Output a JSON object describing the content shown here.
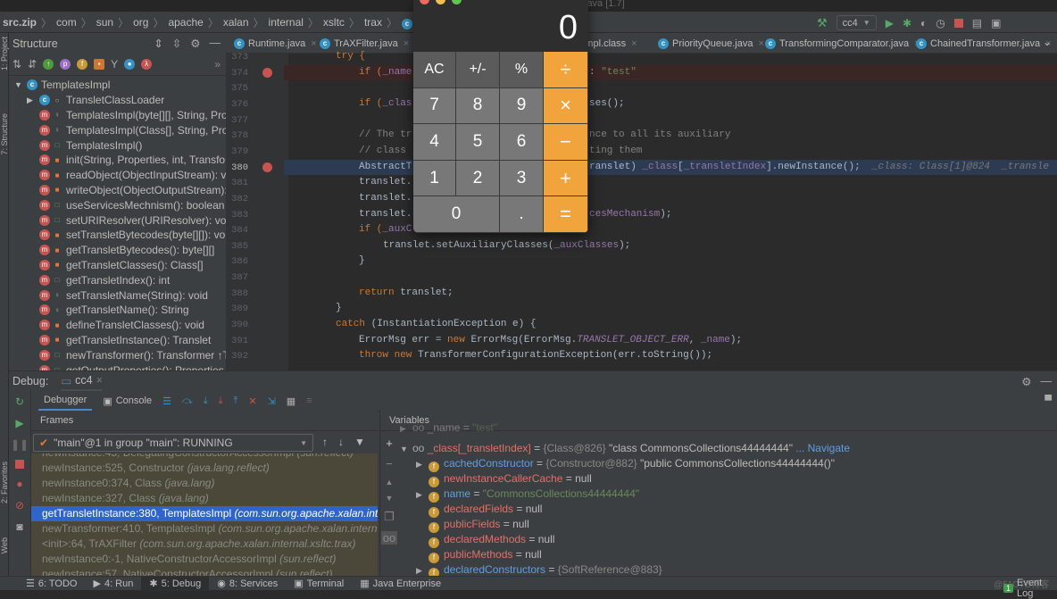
{
  "titlebar": {
    "text": "java [1.7]"
  },
  "breadcrumb": [
    "src.zip",
    "com",
    "sun",
    "org",
    "apache",
    "xalan",
    "internal",
    "xsltc",
    "trax",
    "TemplatesImpl"
  ],
  "run_config": "cc4",
  "structure": {
    "title": "Structure",
    "root": "TemplatesImpl",
    "items": [
      {
        "label": "TransletClassLoader",
        "kind": "class",
        "access": "package"
      },
      {
        "label": "TemplatesImpl(byte[][], String, Pro",
        "kind": "method",
        "access": "protected"
      },
      {
        "label": "TemplatesImpl(Class[], String, Prop",
        "kind": "method",
        "access": "protected"
      },
      {
        "label": "TemplatesImpl()",
        "kind": "method",
        "access": "public"
      },
      {
        "label": "init(String, Properties, int, Transfor",
        "kind": "method",
        "access": "private"
      },
      {
        "label": "readObject(ObjectInputStream): vo",
        "kind": "method",
        "access": "private"
      },
      {
        "label": "writeObject(ObjectOutputStream):",
        "kind": "method",
        "access": "private"
      },
      {
        "label": "useServicesMechnism(): boolean",
        "kind": "method",
        "access": "public"
      },
      {
        "label": "setURIResolver(URIResolver): void",
        "kind": "method",
        "access": "public"
      },
      {
        "label": "setTransletBytecodes(byte[][]): vo",
        "kind": "method",
        "access": "private"
      },
      {
        "label": "getTransletBytecodes(): byte[][]",
        "kind": "method",
        "access": "private"
      },
      {
        "label": "getTransletClasses(): Class[]",
        "kind": "method",
        "access": "private"
      },
      {
        "label": "getTransletIndex(): int",
        "kind": "method",
        "access": "public"
      },
      {
        "label": "setTransletName(String): void",
        "kind": "method",
        "access": "protected"
      },
      {
        "label": "getTransletName(): String",
        "kind": "method",
        "access": "protected"
      },
      {
        "label": "defineTransletClasses(): void",
        "kind": "method",
        "access": "private"
      },
      {
        "label": "getTransletInstance(): Translet",
        "kind": "method",
        "access": "private"
      },
      {
        "label": "newTransformer(): Transformer ↑Te",
        "kind": "method",
        "access": "public"
      },
      {
        "label": "getOutputProperties(): Properties",
        "kind": "method",
        "access": "public"
      }
    ]
  },
  "tabs": [
    {
      "label": "Runtime.java"
    },
    {
      "label": "TrAXFilter.java"
    },
    {
      "label": "onImpl.class"
    },
    {
      "label": "PriorityQueue.java"
    },
    {
      "label": "TransformingComparator.java"
    },
    {
      "label": "ChainedTransformer.java"
    }
  ],
  "code": [
    {
      "n": "373",
      "indent": 2,
      "left": [
        [
          "try {",
          "kw"
        ]
      ]
    },
    {
      "n": "374",
      "indent": 3,
      "bp": true,
      "hl": "error",
      "left": [
        [
          "if (",
          "kw"
        ],
        [
          "_name",
          "fld"
        ]
      ],
      "right": [
        [
          ": ",
          "pl"
        ],
        [
          "\"test\"",
          "str"
        ]
      ]
    },
    {
      "n": "375",
      "indent": 3,
      "left": []
    },
    {
      "n": "376",
      "indent": 3,
      "left": [
        [
          "if (",
          "kw"
        ],
        [
          "_clas",
          "fld"
        ]
      ],
      "right": [
        [
          "ses();",
          "pl"
        ]
      ]
    },
    {
      "n": "377",
      "indent": 3,
      "left": []
    },
    {
      "n": "378",
      "indent": 3,
      "left": [
        [
          "// The tr",
          "cm"
        ]
      ],
      "right": [
        [
          "nce to all its auxiliary",
          "cm"
        ]
      ]
    },
    {
      "n": "379",
      "indent": 3,
      "left": [
        [
          "// class ",
          "cm"
        ]
      ],
      "right": [
        [
          "ting them",
          "cm"
        ]
      ]
    },
    {
      "n": "380",
      "indent": 3,
      "bp": true,
      "hl": "exec",
      "left": [
        [
          "AbstractT",
          "pl"
        ]
      ],
      "right": [
        [
          "ranslet) ",
          "pl"
        ],
        [
          "_class",
          "fld"
        ],
        [
          "[",
          "pl"
        ],
        [
          "_transletIndex",
          "fld"
        ],
        [
          "].newInstance();",
          "pl"
        ],
        [
          "  _class: Class[1]@824  _transle",
          "hint"
        ]
      ]
    },
    {
      "n": "381",
      "indent": 3,
      "left": [
        [
          "translet.",
          "pl"
        ]
      ]
    },
    {
      "n": "382",
      "indent": 3,
      "left": [
        [
          "translet.",
          "pl"
        ]
      ]
    },
    {
      "n": "383",
      "indent": 3,
      "left": [
        [
          "translet.",
          "pl"
        ]
      ],
      "right": [
        [
          "cesMechanism",
          "fld"
        ],
        [
          ");",
          "pl"
        ]
      ]
    },
    {
      "n": "384",
      "indent": 3,
      "left": [
        [
          "if (",
          "kw"
        ],
        [
          "_auxC",
          "fld"
        ]
      ]
    },
    {
      "n": "385",
      "indent": 4,
      "left": [
        [
          "translet.setAuxiliaryClasses(",
          "pl"
        ],
        [
          "_auxClasses",
          "fld"
        ],
        [
          ");",
          "pl"
        ]
      ]
    },
    {
      "n": "386",
      "indent": 3,
      "left": [
        [
          "}",
          "pl"
        ]
      ]
    },
    {
      "n": "387",
      "indent": 3,
      "left": []
    },
    {
      "n": "388",
      "indent": 3,
      "left": [
        [
          "return ",
          "kw"
        ],
        [
          "translet;",
          "pl"
        ]
      ]
    },
    {
      "n": "389",
      "indent": 2,
      "left": [
        [
          "}",
          "pl"
        ]
      ]
    },
    {
      "n": "390",
      "indent": 2,
      "left": [
        [
          "catch ",
          "kw"
        ],
        [
          "(InstantiationException e) {",
          "pl"
        ]
      ]
    },
    {
      "n": "391",
      "indent": 3,
      "left": [
        [
          "ErrorMsg err = ",
          "pl"
        ],
        [
          "new ",
          "kw"
        ],
        [
          "ErrorMsg(ErrorMsg.",
          "pl"
        ],
        [
          "TRANSLET_OBJECT_ERR",
          "it"
        ],
        [
          ", ",
          "pl"
        ],
        [
          "_name",
          "fld"
        ],
        [
          ");",
          "pl"
        ]
      ]
    },
    {
      "n": "392",
      "indent": 3,
      "left": [
        [
          "throw new ",
          "kw"
        ],
        [
          "TransformerConfigurationException(err.toString());",
          "pl"
        ]
      ]
    }
  ],
  "calculator": {
    "display": "0",
    "keys": [
      [
        "AC",
        "+/-",
        "%",
        "÷"
      ],
      [
        "7",
        "8",
        "9",
        "×"
      ],
      [
        "4",
        "5",
        "6",
        "−"
      ],
      [
        "1",
        "2",
        "3",
        "+"
      ],
      [
        "0",
        ".",
        "="
      ]
    ]
  },
  "debug": {
    "label": "Debug:",
    "session": "cc4",
    "tabs": {
      "debugger": "Debugger",
      "console": "Console"
    },
    "frames_title": "Frames",
    "thread": "\"main\"@1 in group \"main\": RUNNING",
    "frames": [
      {
        "method": "newInstance:45, DelegatingConstructorAccessorImpl",
        "pkg": "(sun.reflect)"
      },
      {
        "method": "newInstance:525, Constructor",
        "pkg": "(java.lang.reflect)"
      },
      {
        "method": "newInstance0:374, Class",
        "pkg": "(java.lang)"
      },
      {
        "method": "newInstance:327, Class",
        "pkg": "(java.lang)"
      },
      {
        "method": "getTransletInstance:380, TemplatesImpl",
        "pkg": "(com.sun.org.apache.xalan.internal.xsltc.trax)",
        "selected": true
      },
      {
        "method": "newTransformer:410, TemplatesImpl",
        "pkg": "(com.sun.org.apache.xalan.internal.xsltc.trax)"
      },
      {
        "method": "<init>:64, TrAXFilter",
        "pkg": "(com.sun.org.apache.xalan.internal.xsltc.trax)"
      },
      {
        "method": "newInstance0:-1, NativeConstructorAccessorImpl",
        "pkg": "(sun.reflect)"
      },
      {
        "method": "newInstance:57, NativeConstructorAccessorImpl",
        "pkg": "(sun.reflect)"
      }
    ],
    "variables_title": "Variables",
    "variables": [
      {
        "depth": 0,
        "arrow": "▶",
        "icon": "watch",
        "name": "_name",
        "eq": " = ",
        "type": "",
        "value": "\"test\"",
        "color": "plain",
        "vcolor": "str"
      },
      {
        "depth": 0,
        "arrow": "▼",
        "icon": "watch",
        "name": "_class[_transletIndex]",
        "eq": " = ",
        "type": "{Class@826} ",
        "value": "\"class CommonsCollections44444444\"",
        "link": " ... Navigate",
        "color": "red"
      },
      {
        "depth": 1,
        "arrow": "▶",
        "icon": "field",
        "name": "cachedConstructor",
        "eq": " = ",
        "type": "{Constructor@882} ",
        "value": "\"public CommonsCollections44444444()\"",
        "color": "blue"
      },
      {
        "depth": 1,
        "arrow": "",
        "icon": "field",
        "name": "newInstanceCallerCache",
        "eq": " = ",
        "type": "",
        "value": "null",
        "color": "red"
      },
      {
        "depth": 1,
        "arrow": "▶",
        "icon": "field",
        "name": "name",
        "eq": " = ",
        "type": "",
        "value": "\"CommonsCollections44444444\"",
        "color": "blue",
        "vcolor": "str"
      },
      {
        "depth": 1,
        "arrow": "",
        "icon": "field",
        "name": "declaredFields",
        "eq": " = ",
        "type": "",
        "value": "null",
        "color": "red"
      },
      {
        "depth": 1,
        "arrow": "",
        "icon": "field",
        "name": "publicFields",
        "eq": " = ",
        "type": "",
        "value": "null",
        "color": "red"
      },
      {
        "depth": 1,
        "arrow": "",
        "icon": "field",
        "name": "declaredMethods",
        "eq": " = ",
        "type": "",
        "value": "null",
        "color": "red"
      },
      {
        "depth": 1,
        "arrow": "",
        "icon": "field",
        "name": "publicMethods",
        "eq": " = ",
        "type": "",
        "value": "null",
        "color": "red"
      },
      {
        "depth": 1,
        "arrow": "▶",
        "icon": "field",
        "name": "declaredConstructors",
        "eq": " = ",
        "type": "{SoftReference@883}",
        "value": "",
        "color": "blue"
      }
    ]
  },
  "statusbar": {
    "items": [
      {
        "label": "6: TODO",
        "icon": "list-icon"
      },
      {
        "label": "4: Run",
        "icon": "play-icon"
      },
      {
        "label": "5: Debug",
        "icon": "bug-icon",
        "active": true
      },
      {
        "label": "8: Services",
        "icon": "services-icon"
      },
      {
        "label": "Terminal",
        "icon": "terminal-icon"
      },
      {
        "label": "Java Enterprise",
        "icon": "enterprise-icon"
      }
    ],
    "event_log": "Event Log",
    "event_count": "1",
    "watermark": "@51CTO博客"
  },
  "sidebar_tabs": [
    "1: Project",
    "7: Structure",
    "2: Favorites",
    "Web"
  ],
  "colors": {
    "accent": "#2f65ca",
    "calc_op": "#f1a33c",
    "breakpoint": "#c75450",
    "keyword": "#cc7832"
  }
}
